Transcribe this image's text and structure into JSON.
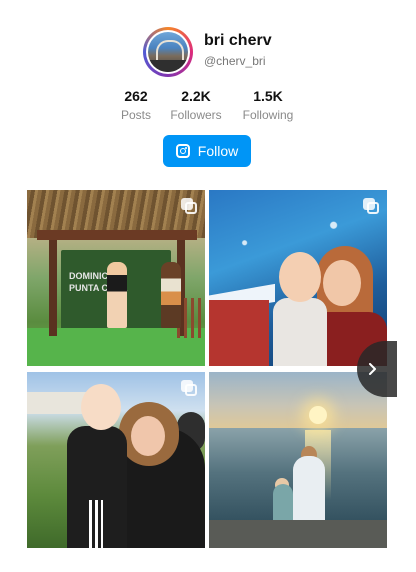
{
  "profile": {
    "name": "bri cherv",
    "handle": "@cherv_bri"
  },
  "stats": [
    {
      "value": "262",
      "label": "Posts"
    },
    {
      "value": "2.2K",
      "label": "Followers"
    },
    {
      "value": "1.5K",
      "label": "Following"
    }
  ],
  "follow": {
    "label": "Follow",
    "icon": "instagram-icon",
    "color": "#0095f6"
  },
  "tile1": {
    "sign": "DOMINICAN PUNTA CANA"
  },
  "icons": {
    "multi": "multiple-images-icon",
    "next": "chevron-right-icon"
  }
}
